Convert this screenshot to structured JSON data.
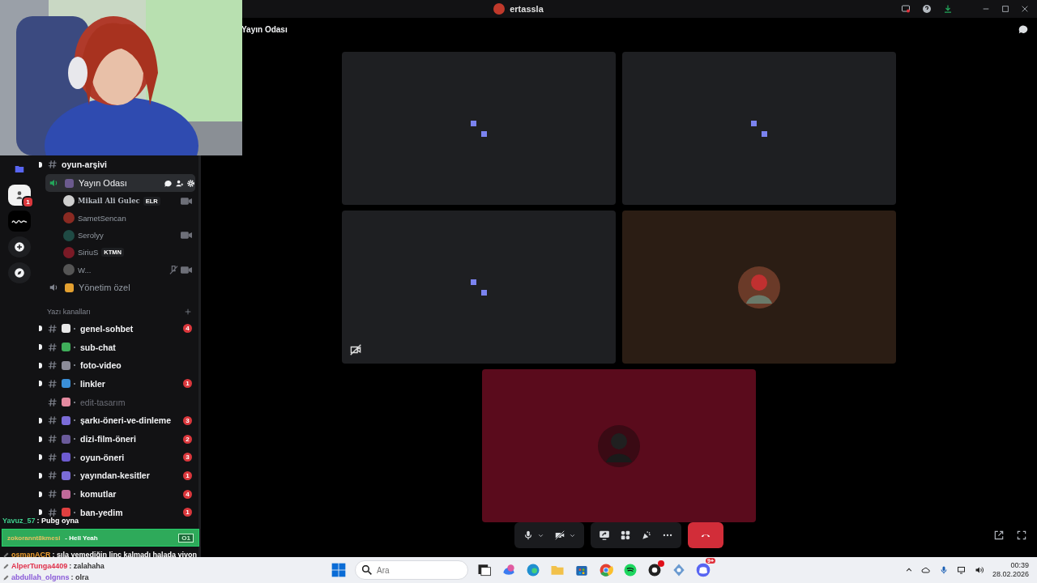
{
  "window": {
    "title": "ertassla"
  },
  "header": {
    "title": "Yayın Odası"
  },
  "servers": [
    {
      "kind": "folder"
    },
    {
      "kind": "light",
      "badge": "1"
    },
    {
      "kind": "dark"
    },
    {
      "kind": "add"
    },
    {
      "kind": "discover"
    }
  ],
  "channels": [
    {
      "kind": "text",
      "name": "oyun-arşivi",
      "unread": true
    },
    {
      "kind": "voice",
      "name": "Yayın Odası",
      "selected": true,
      "color": "#6b5a8e",
      "members": [
        {
          "name": "Mikail Ali Gulec",
          "tag": "ELR",
          "camera": true,
          "muted": false,
          "color": "#cfcfcf"
        },
        {
          "name": "SametSencan",
          "camera": false,
          "muted": false,
          "color": "#8a2a22"
        },
        {
          "name": "Serolyy",
          "camera": true,
          "muted": false,
          "color": "#1f4a44"
        },
        {
          "name": "SiriuS",
          "tag": "KTMN",
          "camera": false,
          "muted": false,
          "color": "#7a1a26"
        },
        {
          "name": "W...",
          "camera": true,
          "muted": true,
          "color": "#555555"
        }
      ]
    },
    {
      "kind": "voice",
      "name": "Yönetim özel",
      "selected": false,
      "color": "#e3a030"
    },
    {
      "kind": "category",
      "name": "Yazı kanalları"
    },
    {
      "kind": "text",
      "name": "genel-sohbet",
      "unread": true,
      "badge": "4",
      "color": "#e8e8e8"
    },
    {
      "kind": "text",
      "name": "sub-chat",
      "unread": true,
      "color": "#3fae5a"
    },
    {
      "kind": "text",
      "name": "foto-video",
      "unread": true,
      "color": "#8c8c99"
    },
    {
      "kind": "text",
      "name": "linkler",
      "unread": true,
      "badge": "1",
      "color": "#3a8fd8"
    },
    {
      "kind": "text",
      "name": "edit-tasarım",
      "unread": false,
      "color": "#e48aa0"
    },
    {
      "kind": "text",
      "name": "şarkı-öneri-ve-dinleme",
      "unread": true,
      "badge": "3",
      "color": "#7b6cd8"
    },
    {
      "kind": "text",
      "name": "dizi-film-öneri",
      "unread": true,
      "badge": "2",
      "color": "#6a5a9a"
    },
    {
      "kind": "text",
      "name": "oyun-öneri",
      "unread": true,
      "badge": "3",
      "color": "#6d5bd0"
    },
    {
      "kind": "text",
      "name": "yayından-kesitler",
      "unread": true,
      "badge": "1",
      "color": "#7b6cd8"
    },
    {
      "kind": "text",
      "name": "komutlar",
      "unread": true,
      "badge": "4",
      "color": "#c06a9a"
    },
    {
      "kind": "text",
      "name": "ban-yedim",
      "unread": true,
      "badge": "1",
      "color": "#e04040"
    }
  ],
  "tiles": [
    {
      "kind": "loading",
      "color": "#1e1f22",
      "video_off": false
    },
    {
      "kind": "loading",
      "color": "#1e1f22",
      "video_off": false
    },
    {
      "kind": "loading",
      "color": "#1e1f22",
      "video_off": true
    },
    {
      "kind": "avatar",
      "color": "#2b1d14",
      "video_off": false
    },
    {
      "kind": "avatar",
      "color": "#5a0b1c",
      "video_off": false
    }
  ],
  "controls": [
    {
      "kind": "mic"
    },
    {
      "kind": "camera_off"
    },
    {
      "kind": "share"
    },
    {
      "kind": "activities"
    },
    {
      "kind": "soundboard"
    },
    {
      "kind": "more"
    },
    {
      "kind": "hangup"
    }
  ],
  "stream_chat": [
    {
      "kind": "plain",
      "user": "Yavuz_57",
      "text": ": Pubg oyna",
      "color": "#3fcf8e"
    },
    {
      "kind": "alert",
      "user": "zokorannt8kmesi",
      "text": "- Hell Yeah",
      "counter": "O1",
      "color": "#e8c060"
    },
    {
      "kind": "plain",
      "user": "osmanACR",
      "text": ": sıla yemediğin linç kalmadı halada yiyon",
      "color": "#f0a030"
    },
    {
      "kind": "plain",
      "user": "AlperTunga4409",
      "text": ": zalahaha",
      "color": "#e0304a"
    },
    {
      "kind": "plain",
      "user": "abdullah_olgnns",
      "text": ": olra",
      "color": "#8a5ad8"
    }
  ],
  "taskbar": {
    "search": {
      "placeholder": "Ara"
    },
    "apps": [
      {
        "kind": "taskview"
      },
      {
        "kind": "copilot"
      },
      {
        "kind": "edge"
      },
      {
        "kind": "files"
      },
      {
        "kind": "store"
      },
      {
        "kind": "chrome"
      },
      {
        "kind": "spotify"
      },
      {
        "kind": "obs",
        "badge": true
      },
      {
        "kind": "tool"
      },
      {
        "kind": "discord",
        "count": "9+"
      }
    ],
    "time": "00:39",
    "date": "28.02.2026"
  }
}
